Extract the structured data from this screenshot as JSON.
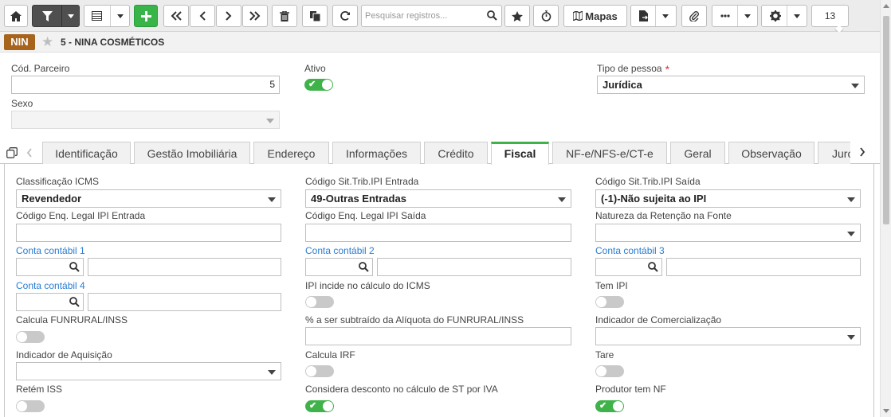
{
  "toolbar": {
    "search_placeholder": "Pesquisar registros...",
    "maps_label": "Mapas",
    "page_number": "13"
  },
  "header": {
    "badge": "NIN",
    "title": "5 - NINA COSMÉTICOS"
  },
  "form": {
    "cod_parceiro_label": "Cód. Parceiro",
    "cod_parceiro_value": "5",
    "ativo_label": "Ativo",
    "ativo_checked": true,
    "tipo_pessoa_label": "Tipo de pessoa",
    "tipo_pessoa_required": "*",
    "tipo_pessoa_value": "Jurídica",
    "sexo_label": "Sexo",
    "sexo_value": ""
  },
  "tabs": [
    "Identificação",
    "Gestão Imobiliária",
    "Endereço",
    "Informações",
    "Crédito",
    "Fiscal",
    "NF-e/NFS-e/CT-e",
    "Geral",
    "Observação",
    "Juros"
  ],
  "active_tab": "Fiscal",
  "fiscal": {
    "classificacao_icms_label": "Classificação ICMS",
    "classificacao_icms_value": "Revendedor",
    "cst_ipi_entrada_label": "Código Sit.Trib.IPI Entrada",
    "cst_ipi_entrada_value": "49-Outras Entradas",
    "cst_ipi_saida_label": "Código Sit.Trib.IPI Saída",
    "cst_ipi_saida_value": "(-1)-Não sujeita ao IPI",
    "enq_ipi_entrada_label": "Código Enq. Legal IPI Entrada",
    "enq_ipi_saida_label": "Código Enq. Legal IPI Saída",
    "natureza_retencao_label": "Natureza da Retenção na Fonte",
    "conta1_label": "Conta contábil 1",
    "conta2_label": "Conta contábil 2",
    "conta3_label": "Conta contábil 3",
    "conta4_label": "Conta contábil 4",
    "ipi_icms_label": "IPI incide no cálculo do ICMS",
    "ipi_icms_checked": false,
    "tem_ipi_label": "Tem IPI",
    "tem_ipi_checked": false,
    "funrural_label": "Calcula FUNRURAL/INSS",
    "funrural_checked": false,
    "percent_funrural_label": "% a ser subtraído da Alíquota do FUNRURAL/INSS",
    "ind_comerc_label": "Indicador de Comercialização",
    "ind_aquis_label": "Indicador de Aquisição",
    "calcula_irf_label": "Calcula IRF",
    "calcula_irf_checked": false,
    "tare_label": "Tare",
    "tare_checked": false,
    "retem_iss_label": "Retém ISS",
    "retem_iss_checked": false,
    "desconto_st_label": "Considera desconto no cálculo de ST por IVA",
    "desconto_st_checked": true,
    "produtor_nf_label": "Produtor tem NF",
    "produtor_nf_checked": true
  },
  "colors": {
    "accent": "#3fb24a",
    "badge": "#a7641d",
    "link": "#2a7dd4"
  }
}
